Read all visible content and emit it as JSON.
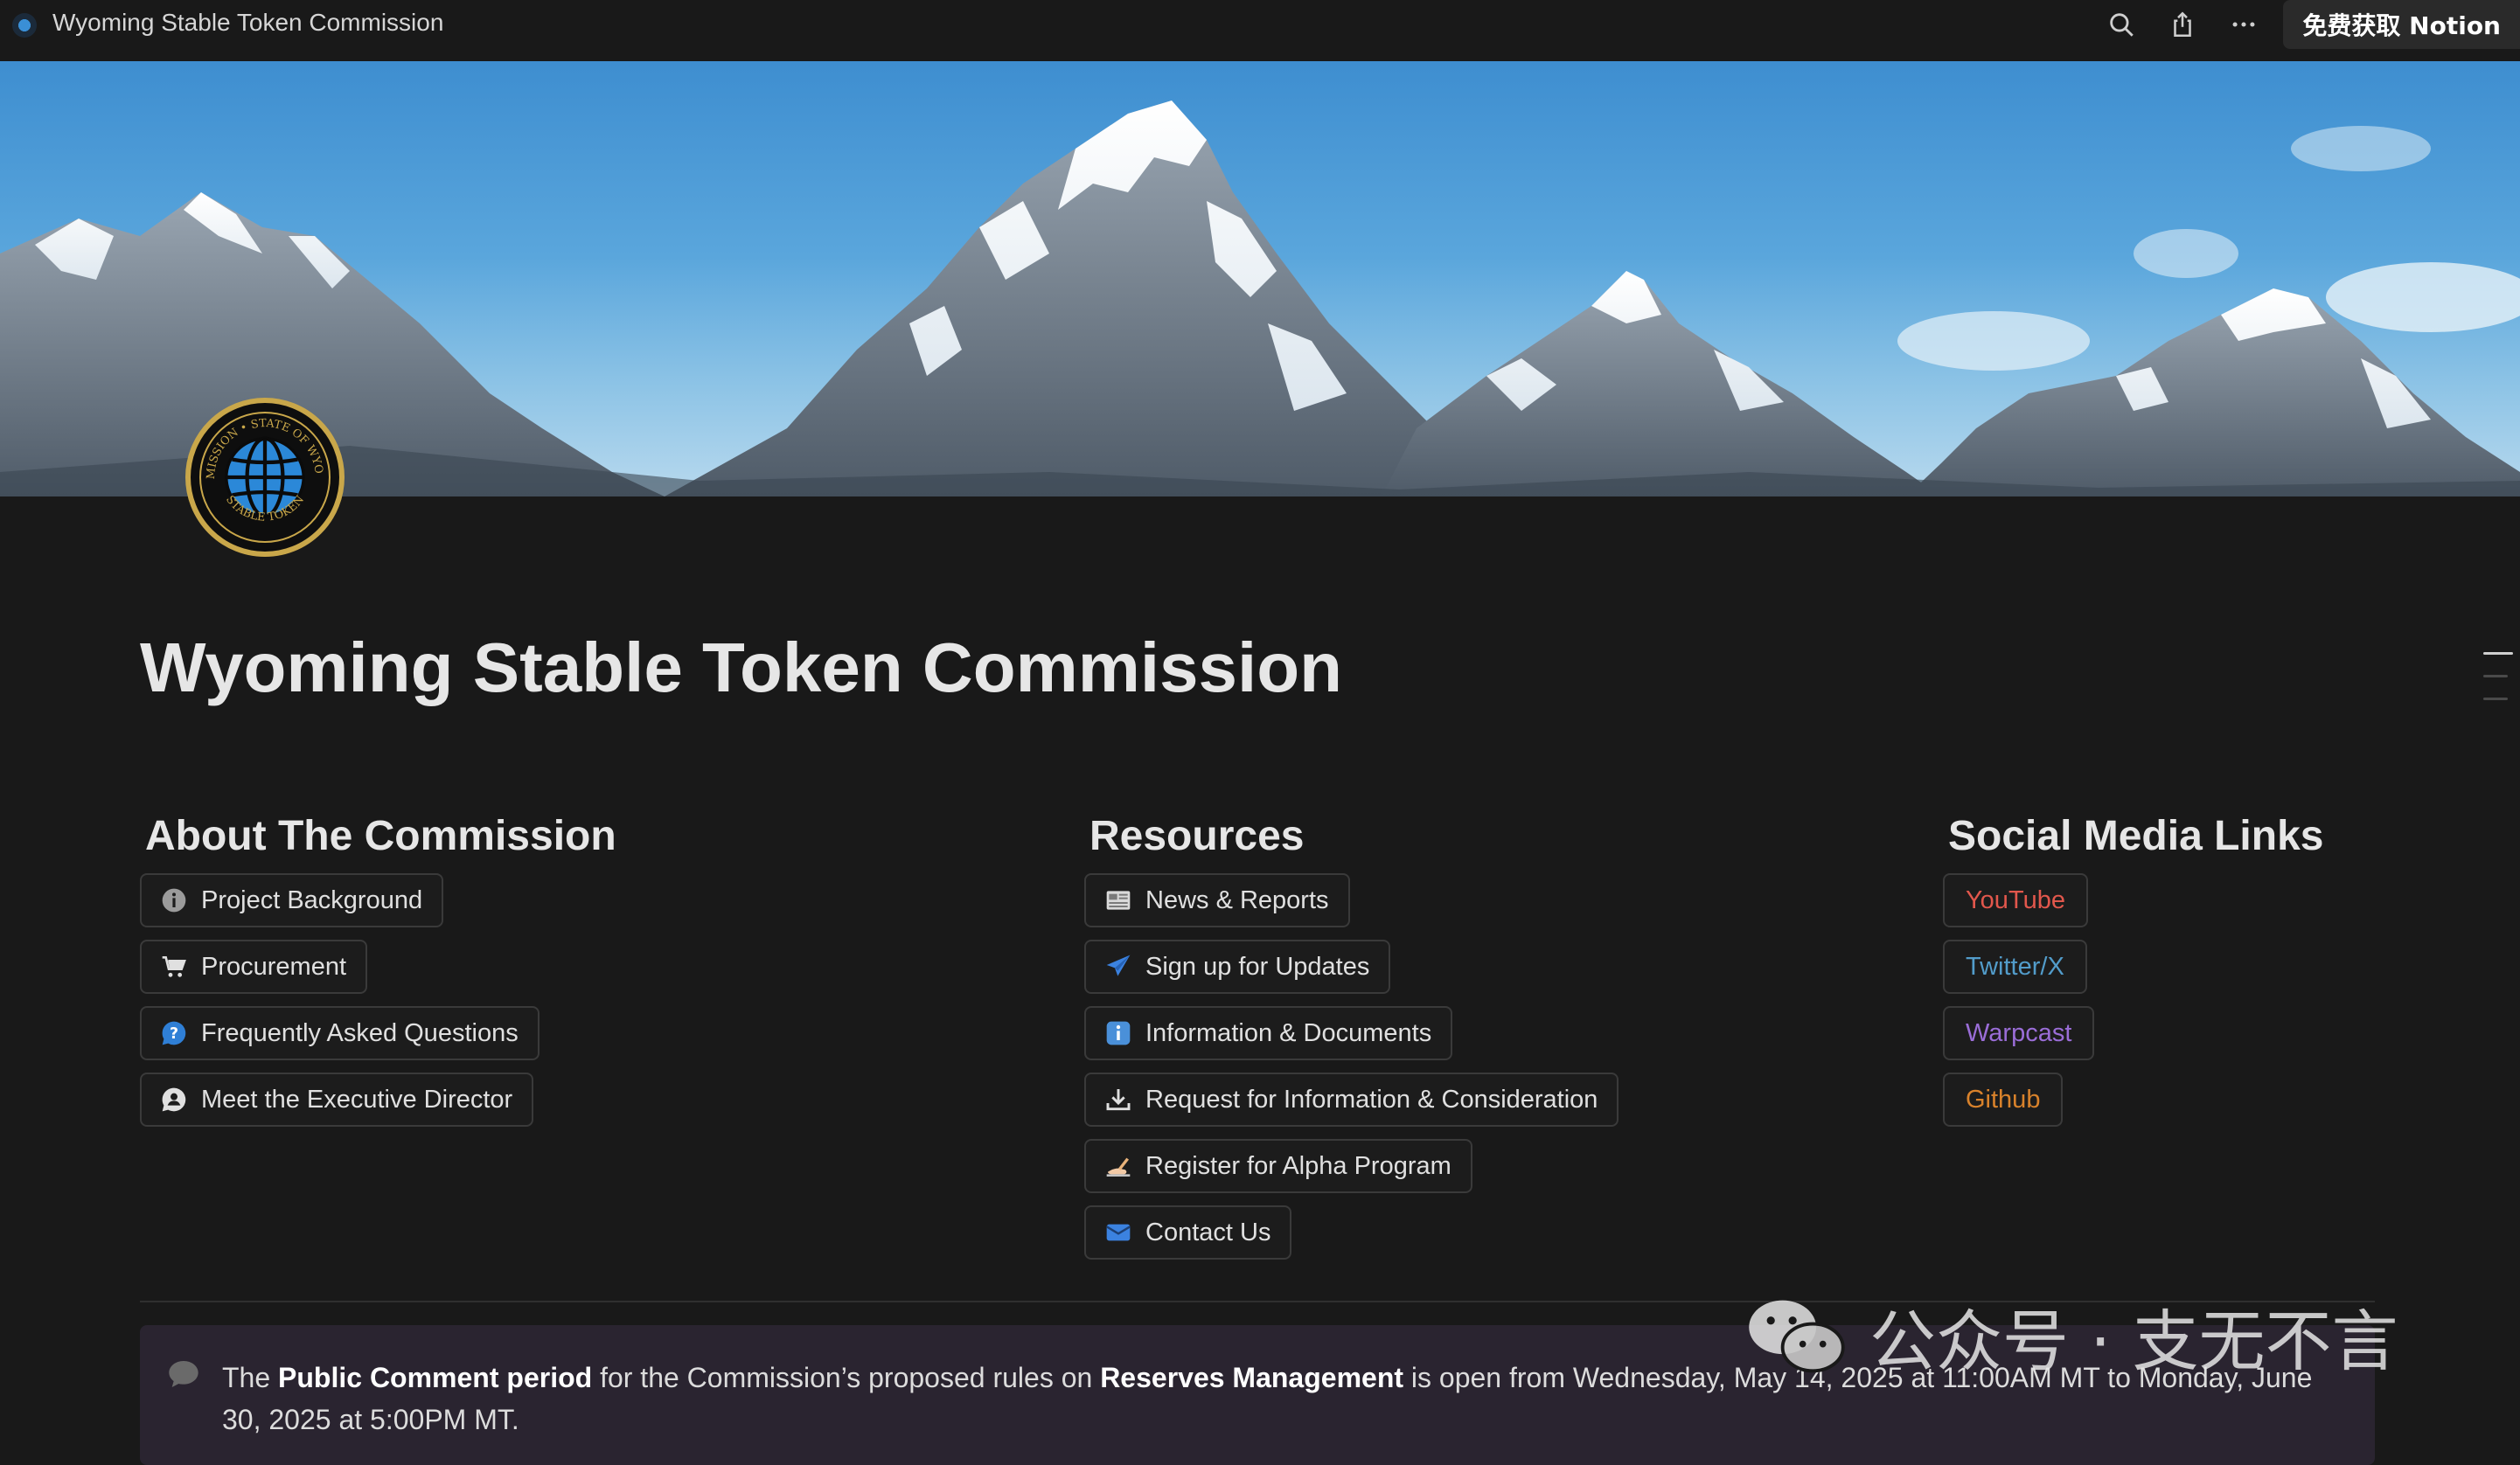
{
  "window": {
    "tab_title": "Wyoming Stable Token Commission",
    "get_notion_label": "免费获取 Notion",
    "icons": [
      "search-icon",
      "share-icon",
      "more-icon"
    ]
  },
  "page": {
    "title": "Wyoming Stable Token Commission",
    "seal_text_top": "COMMISSION • STATE OF WYOMING",
    "seal_text_bottom": "STABLE TOKEN"
  },
  "about": {
    "heading": "About The Commission",
    "items": [
      {
        "label": "Project Background",
        "icon": "info-icon"
      },
      {
        "label": "Procurement",
        "icon": "cart-icon"
      },
      {
        "label": "Frequently Asked Questions",
        "icon": "question-bubble-icon"
      },
      {
        "label": "Meet the Executive Director",
        "icon": "person-bubble-icon"
      }
    ]
  },
  "resources": {
    "heading": "Resources",
    "items": [
      {
        "label": "News & Reports",
        "icon": "newspaper-icon"
      },
      {
        "label": "Sign up for Updates",
        "icon": "paper-plane-icon"
      },
      {
        "label": "Information & Documents",
        "icon": "information-icon"
      },
      {
        "label": "Request for Information & Consideration",
        "icon": "download-icon"
      },
      {
        "label": "Register for Alpha Program",
        "icon": "writing-hand-icon"
      },
      {
        "label": "Contact Us",
        "icon": "envelope-icon"
      }
    ]
  },
  "social": {
    "heading": "Social Media Links",
    "items": [
      {
        "label": "YouTube",
        "color": "#e2574c"
      },
      {
        "label": "Twitter/X",
        "color": "#529cca"
      },
      {
        "label": "Warpcast",
        "color": "#9a6dd7"
      },
      {
        "label": "Github",
        "color": "#d9822b"
      }
    ]
  },
  "callout": {
    "icon": "speech-bubble-icon",
    "t1": "The ",
    "b1": "Public Comment period",
    "t2": " for the Commission’s proposed rules on ",
    "b2": "Reserves Management",
    "t3": " is open from Wednesday, May 14, 2025 at 11:00AM MT to Monday, June 30, 2025 at 5:00PM MT."
  },
  "watermark": {
    "text": "公众号 · 支无不言",
    "icon": "wechat-icon"
  }
}
